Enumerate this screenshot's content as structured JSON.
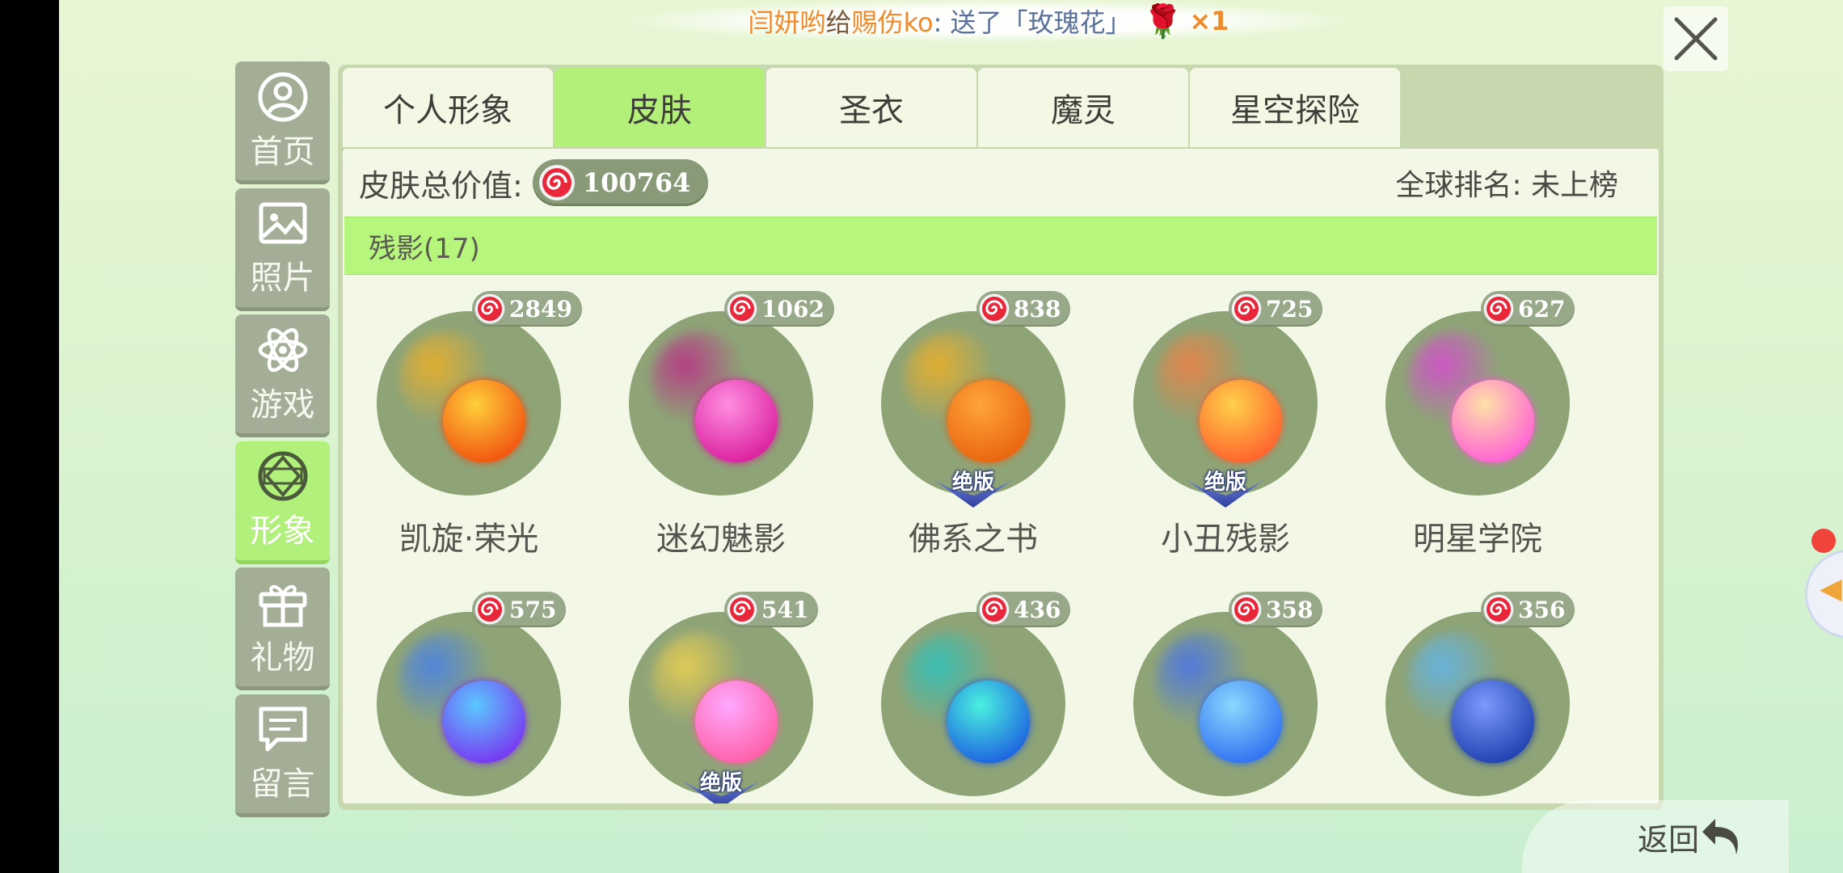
{
  "banner": {
    "sender": "闫妍哟",
    "verb": "给",
    "receiver": "赐伤ko",
    "action": ":  送了",
    "gift_name": "「玫瑰花」",
    "rose_glyph": "🌹",
    "count": "×1"
  },
  "sidebar": {
    "items": [
      {
        "label": "首页",
        "icon": "person-icon",
        "active": false
      },
      {
        "label": "照片",
        "icon": "picture-icon",
        "active": false
      },
      {
        "label": "游戏",
        "icon": "atom-icon",
        "active": false
      },
      {
        "label": "形象",
        "icon": "diamond-icon",
        "active": true
      },
      {
        "label": "礼物",
        "icon": "gift-icon",
        "active": false
      },
      {
        "label": "留言",
        "icon": "message-icon",
        "active": false
      }
    ]
  },
  "tabs": [
    {
      "label": "个人形象",
      "active": false
    },
    {
      "label": "皮肤",
      "active": true
    },
    {
      "label": "圣衣",
      "active": false
    },
    {
      "label": "魔灵",
      "active": false
    },
    {
      "label": "星空探险",
      "active": false
    }
  ],
  "summary": {
    "total_label": "皮肤总价值:",
    "total_value": "100764",
    "rank_label": "全球排名: 未上榜"
  },
  "section": {
    "title": "残影(17)"
  },
  "skins": [
    {
      "name": "凯旋·荣光",
      "price": "2849",
      "limited": false,
      "orb": [
        "#ffcf3a",
        "#f04a0c"
      ],
      "trail": "#ffb21a"
    },
    {
      "name": "迷幻魅影",
      "price": "1062",
      "limited": false,
      "orb": [
        "#ff8ee0",
        "#d8189a"
      ],
      "trail": "#c21a8a"
    },
    {
      "name": "佛系之书",
      "price": "838",
      "limited": true,
      "orb": [
        "#ffa43a",
        "#e8600c"
      ],
      "trail": "#ffb21a"
    },
    {
      "name": "小丑残影",
      "price": "725",
      "limited": true,
      "orb": [
        "#ffd04a",
        "#ff5a2a"
      ],
      "trail": "#ff7a3a"
    },
    {
      "name": "明星学院",
      "price": "627",
      "limited": false,
      "orb": [
        "#ffe0a8",
        "#ff58d8"
      ],
      "trail": "#e43ae0"
    },
    {
      "name": "",
      "price": "575",
      "limited": false,
      "orb": [
        "#5ac8ff",
        "#7a2cf0"
      ],
      "trail": "#3a7aff"
    },
    {
      "name": "",
      "price": "541",
      "limited": true,
      "orb": [
        "#ffa8ff",
        "#ff5aa0"
      ],
      "trail": "#ffd84a"
    },
    {
      "name": "",
      "price": "436",
      "limited": false,
      "orb": [
        "#4af0e0",
        "#1a58e0"
      ],
      "trail": "#1ac8c8"
    },
    {
      "name": "",
      "price": "358",
      "limited": false,
      "orb": [
        "#8ad8ff",
        "#2a6af0"
      ],
      "trail": "#3a6aff"
    },
    {
      "name": "",
      "price": "356",
      "limited": false,
      "orb": [
        "#7a9aff",
        "#1a3aa8"
      ],
      "trail": "#5ab8ff"
    }
  ],
  "limited_badge": "绝版",
  "back": {
    "label": "返回"
  },
  "colors": {
    "accent_green": "#b3f07a",
    "candy_red": "#e8283a"
  }
}
